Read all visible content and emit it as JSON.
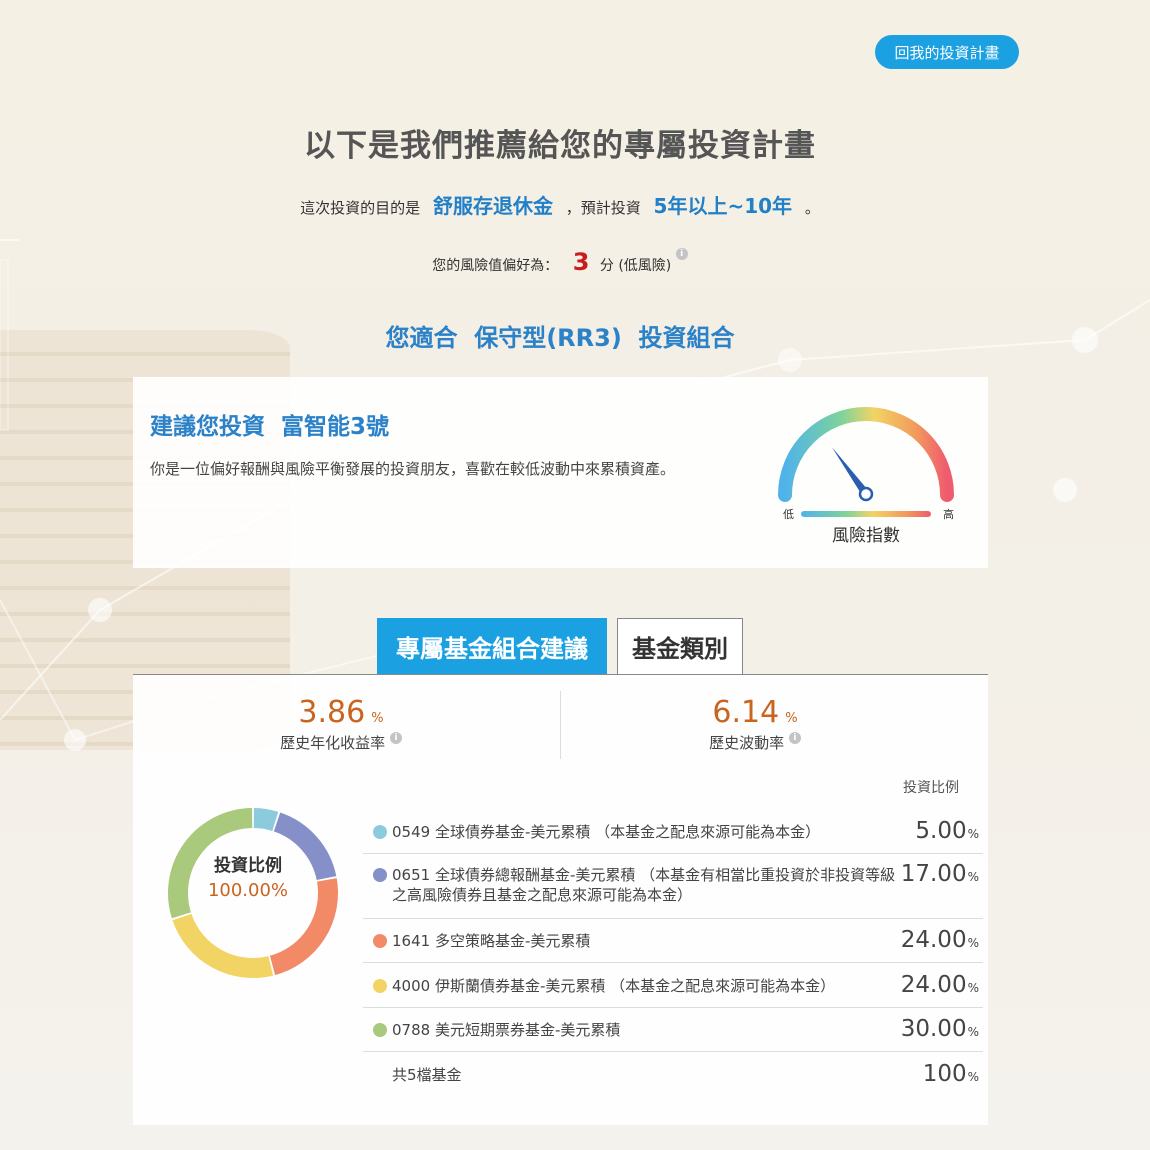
{
  "header": {
    "back_button": "回我的投資計畫"
  },
  "title": "以下是我們推薦給您的專屬投資計畫",
  "purpose": {
    "prefix": "這次投資的目的是",
    "goal": "舒服存退休金",
    "mid": "，預計投資",
    "period": "5年以上~10年",
    "suffix": "。"
  },
  "risk": {
    "prefix": "您的風險值偏好為：",
    "score": "3",
    "suffix": "分 (低風險)",
    "info_icon": "info-icon"
  },
  "suitability": "您適合  保守型(RR3)  投資組合",
  "recommendation": {
    "heading": "建議您投資  富智能3號",
    "description": "你是一位偏好報酬與風險平衡發展的投資朋友，喜歡在較低波動中來累積資產。",
    "gauge": {
      "low_label": "低",
      "high_label": "高",
      "caption": "風險指數",
      "level": 0.3
    }
  },
  "tabs": {
    "active": "專屬基金組合建議",
    "inactive": "基金類別"
  },
  "stats": {
    "return": {
      "value": "3.86",
      "unit": "%",
      "label": "歷史年化收益率"
    },
    "volatility": {
      "value": "6.14",
      "unit": "%",
      "label": "歷史波動率"
    }
  },
  "allocation": {
    "column_header": "投資比例",
    "center_title": "投資比例",
    "center_value": "100.00%",
    "funds": [
      {
        "name": "0549 全球債券基金-美元累積 （本基金之配息來源可能為本金）",
        "pct": "5.00",
        "value": 5,
        "color": "#8ccbdc"
      },
      {
        "name": "0651 全球債券總報酬基金-美元累積 （本基金有相當比重投資於非投資等級之高風險債券且基金之配息來源可能為本金）",
        "pct": "17.00",
        "value": 17,
        "color": "#8590c8"
      },
      {
        "name": "1641 多空策略基金-美元累積",
        "pct": "24.00",
        "value": 24,
        "color": "#f28a68"
      },
      {
        "name": "4000 伊斯蘭債券基金-美元累積 （本基金之配息來源可能為本金）",
        "pct": "24.00",
        "value": 24,
        "color": "#f2d465"
      },
      {
        "name": "0788 美元短期票券基金-美元累積",
        "pct": "30.00",
        "value": 30,
        "color": "#a9c97c"
      }
    ],
    "total_label": "共5檔基金",
    "total_pct": "100",
    "pct_unit": "%"
  }
}
